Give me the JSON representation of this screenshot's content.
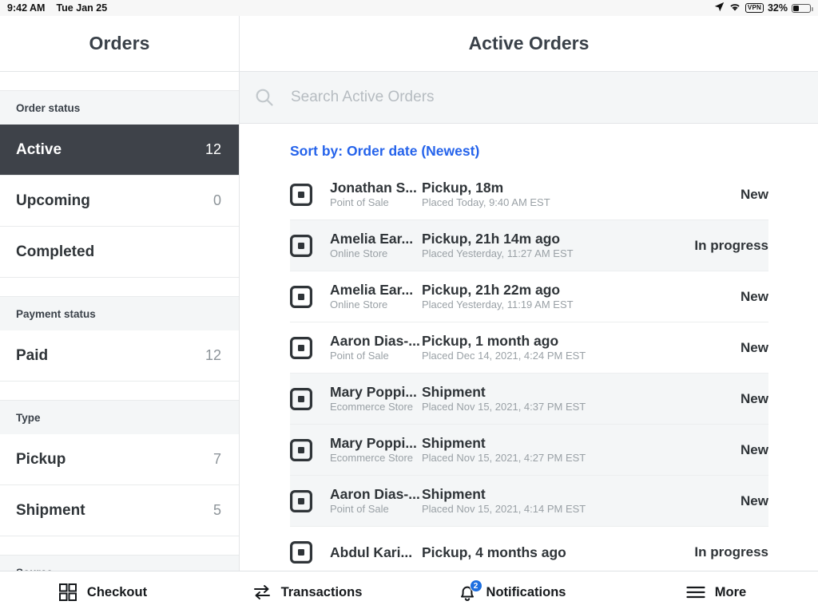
{
  "status_bar": {
    "time": "9:42 AM",
    "date": "Tue Jan 25",
    "vpn_label": "VPN",
    "battery_percent": "32%",
    "battery_level": 32,
    "icons": [
      "location-arrow-icon",
      "wifi-icon",
      "vpn-badge",
      "battery-icon"
    ]
  },
  "sidebar": {
    "title": "Orders",
    "sections": [
      {
        "label": "Order status",
        "items": [
          {
            "label": "Active",
            "count": "12",
            "selected": true
          },
          {
            "label": "Upcoming",
            "count": "0",
            "selected": false
          },
          {
            "label": "Completed",
            "count": "",
            "selected": false
          }
        ]
      },
      {
        "label": "Payment status",
        "items": [
          {
            "label": "Paid",
            "count": "12",
            "selected": false
          }
        ]
      },
      {
        "label": "Type",
        "items": [
          {
            "label": "Pickup",
            "count": "7",
            "selected": false
          },
          {
            "label": "Shipment",
            "count": "5",
            "selected": false
          }
        ]
      },
      {
        "label": "Source",
        "items": []
      }
    ]
  },
  "main": {
    "title": "Active Orders",
    "search": {
      "placeholder": "Search Active Orders",
      "value": "",
      "icon": "search-icon"
    },
    "sort_by": "Sort by: Order date (Newest)",
    "orders": [
      {
        "customer": "Jonathan S...",
        "source": "Point of Sale",
        "detail": "Pickup, 18m",
        "placed": "Placed Today, 9:40 AM EST",
        "status": "New",
        "shaded": false
      },
      {
        "customer": "Amelia Ear...",
        "source": "Online Store",
        "detail": "Pickup, 21h 14m ago",
        "placed": "Placed Yesterday, 11:27 AM EST",
        "status": "In progress",
        "shaded": true
      },
      {
        "customer": "Amelia Ear...",
        "source": "Online Store",
        "detail": "Pickup, 21h 22m ago",
        "placed": "Placed Yesterday, 11:19 AM EST",
        "status": "New",
        "shaded": false
      },
      {
        "customer": "Aaron Dias-...",
        "source": "Point of Sale",
        "detail": "Pickup, 1 month ago",
        "placed": "Placed Dec 14, 2021, 4:24 PM EST",
        "status": "New",
        "shaded": false
      },
      {
        "customer": "Mary Poppi...",
        "source": "Ecommerce Store",
        "detail": "Shipment",
        "placed": "Placed Nov 15, 2021, 4:37 PM EST",
        "status": "New",
        "shaded": true
      },
      {
        "customer": "Mary Poppi...",
        "source": "Ecommerce Store",
        "detail": "Shipment",
        "placed": "Placed Nov 15, 2021, 4:27 PM EST",
        "status": "New",
        "shaded": true
      },
      {
        "customer": "Aaron Dias-...",
        "source": "Point of Sale",
        "detail": "Shipment",
        "placed": "Placed Nov 15, 2021, 4:14 PM EST",
        "status": "New",
        "shaded": true
      },
      {
        "customer": "Abdul Kari...",
        "source": "",
        "detail": "Pickup, 4 months ago",
        "placed": "",
        "status": "In progress",
        "shaded": false
      }
    ]
  },
  "tab_bar": {
    "tabs": [
      {
        "label": "Checkout",
        "icon": "grid-icon",
        "badge": ""
      },
      {
        "label": "Transactions",
        "icon": "transfer-arrows-icon",
        "badge": ""
      },
      {
        "label": "Notifications",
        "icon": "bell-icon",
        "badge": "2"
      },
      {
        "label": "More",
        "icon": "hamburger-menu-icon",
        "badge": ""
      }
    ]
  },
  "colors": {
    "accent_blue": "#2563eb",
    "badge_blue": "#1d6fe0",
    "active_dark": "#3e4249",
    "panel_gray": "#f4f6f7",
    "text_dark": "#2f3438",
    "text_muted": "#9aa1a6"
  }
}
